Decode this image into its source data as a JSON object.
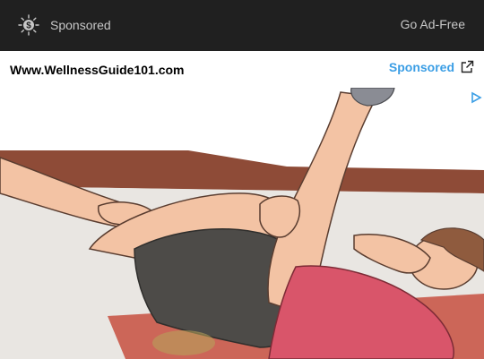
{
  "topbar": {
    "icon": "dollar-sparkle-icon",
    "sponsored_label": "Sponsored",
    "go_ad_free_label": "Go Ad-Free",
    "background": "#202020",
    "text_color": "#c7c7c7"
  },
  "ad": {
    "site": "Www.WellnessGuide101.com",
    "sponsored_label": "Sponsored",
    "sponsored_color": "#3b9ee5",
    "sponsored_icon": "external-link-icon",
    "adchoices_icon": "adchoices-icon",
    "image_subject": "illustration of a person doing a lying leg raise stretch"
  },
  "colors": {
    "skin": "#f3c3a4",
    "shorts": "#4d4b48",
    "shirt": "#d9556a",
    "mat": "#cc6658",
    "wall_stripe": "#8e4b37"
  }
}
